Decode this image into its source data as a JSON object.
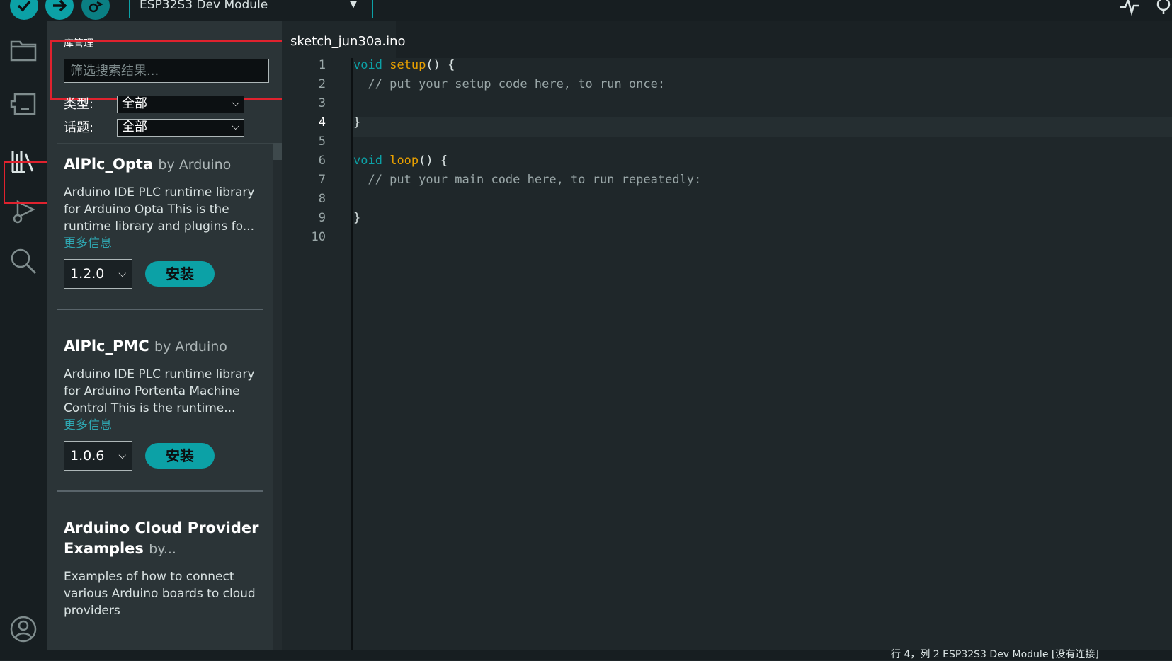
{
  "toolbar": {
    "board_label": "ESP32S3 Dev Module",
    "icons": [
      "verify-icon",
      "upload-icon",
      "debug-icon",
      "serial-plotter-icon",
      "serial-monitor-icon"
    ]
  },
  "activity_bar": {
    "items": [
      "folder-icon",
      "boards-manager-icon",
      "library-manager-icon",
      "debug-icon",
      "search-icon",
      "account-icon"
    ],
    "active": "library-manager-icon"
  },
  "library_manager": {
    "title": "库管理",
    "search_placeholder": "筛选搜索结果...",
    "filters": [
      {
        "label": "类型:",
        "value": "全部"
      },
      {
        "label": "话题:",
        "value": "全部"
      }
    ],
    "libraries": [
      {
        "name": "AlPlc_Opta",
        "author": "by Arduino",
        "description": "Arduino IDE PLC runtime library for Arduino Opta This is the runtime library and plugins fo...",
        "more_info": "更多信息",
        "version": "1.2.0",
        "install_label": "安装"
      },
      {
        "name": "AlPlc_PMC",
        "author": "by Arduino",
        "description": "Arduino IDE PLC runtime library for Arduino Portenta Machine Control This is the runtime...",
        "more_info": "更多信息",
        "version": "1.0.6",
        "install_label": "安装"
      },
      {
        "name": "Arduino Cloud Provider Examples",
        "author": "by...",
        "description": "Examples of how to connect various Arduino boards to cloud providers"
      }
    ]
  },
  "editor": {
    "tab_label": "sketch_jun30a.ino",
    "line_numbers": [
      "1",
      "2",
      "3",
      "4",
      "5",
      "6",
      "7",
      "8",
      "9",
      "10"
    ],
    "active_line": "4",
    "code": {
      "l1_kw": "void",
      "l1_fn": "setup",
      "l1_rest": "() {",
      "l2": "  // put your setup code here, to run once:",
      "l4": "}",
      "l6_kw": "void",
      "l6_fn": "loop",
      "l6_rest": "() {",
      "l7": "  // put your main code here, to run repeatedly:",
      "l9": "}"
    }
  },
  "statusbar": {
    "text": "行 4，列 2   ESP32S3 Dev Module [没有连接]"
  },
  "colors": {
    "accent": "#0ca1a6",
    "highlight_box": "#e0222e",
    "function_name": "#e9a000"
  }
}
